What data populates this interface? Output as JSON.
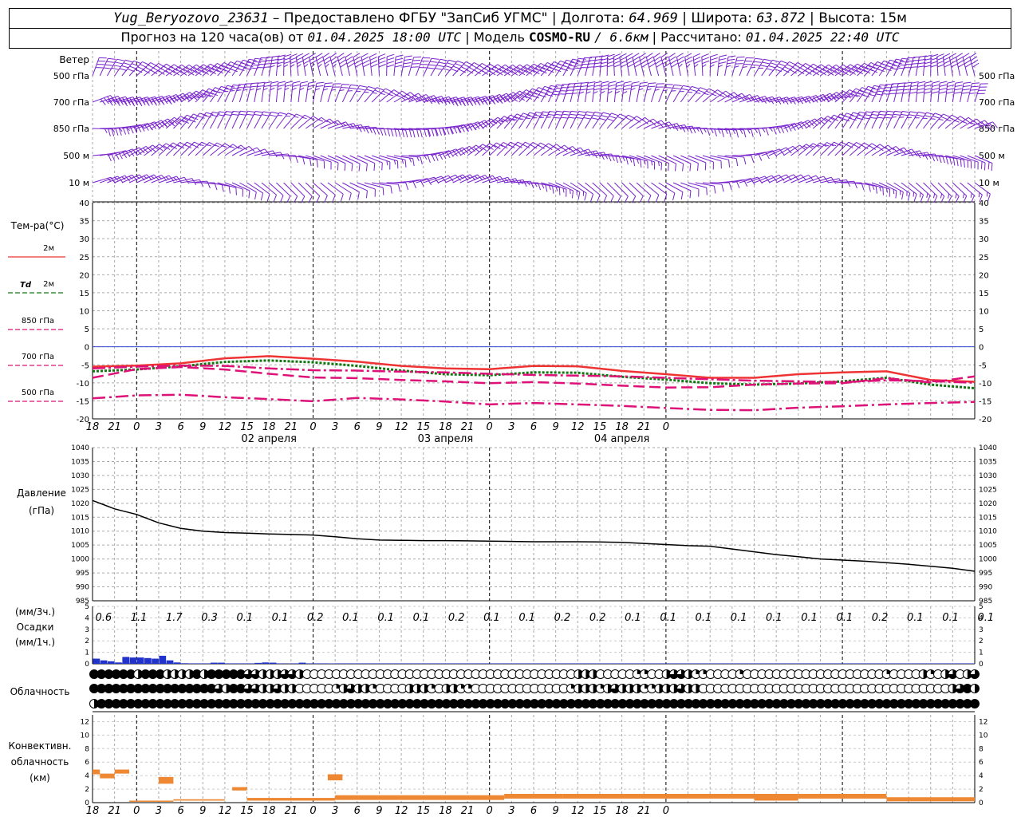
{
  "header": {
    "station": "Yug_Beryozovo_23631",
    "provider": "– Предоставлено ФГБУ \"ЗапСиб УГМС\"",
    "lon_label": "Долгота:",
    "lon": "64.969",
    "lat_label": "Широта:",
    "lat": "63.872",
    "alt_label": "Высота:",
    "alt": "15м",
    "forecast_prefix": "Прогноз на 120 часа(ов) от",
    "forecast_time": "01.04.2025 18:00 UTC",
    "model_label": "Модель",
    "model_name": "COSMO-RU",
    "model_res": "/ 6.6км",
    "calc_label": "Рассчитано:",
    "calc_time": "01.04.2025 22:40 UTC"
  },
  "panel_labels": {
    "wind": "Ветер",
    "wind_levels": [
      "500 гПа",
      "700 гПа",
      "850 гПа",
      "500 м",
      "10 м"
    ],
    "temp": "Тем-ра(°C)",
    "temp_2m": "2м",
    "td_prefix": "Td",
    "td_2m": "2м",
    "t850": "850 гПа",
    "t700": "700 гПа",
    "t500": "500 гПа",
    "pressure": "Давление",
    "pressure_unit": "(гПа)",
    "precip_3h": "(мм/3ч.)",
    "precip": "Осадки",
    "precip_1h": "(мм/1ч.)",
    "cloud": "Облачность",
    "conv1": "Конвективн.",
    "conv2": "облачность",
    "conv3": "(км)"
  },
  "dates": [
    "02 апреля",
    "03 апреля",
    "04 апреля"
  ],
  "hour_ticks": [
    "18",
    "21",
    "0",
    "3",
    "6",
    "9",
    "12",
    "15",
    "18",
    "21",
    "0",
    "3",
    "6",
    "9",
    "12",
    "15",
    "18",
    "21",
    "0",
    "3",
    "6",
    "9",
    "12",
    "15",
    "18",
    "21",
    "0"
  ],
  "temp_axis": [
    "40",
    "35",
    "30",
    "25",
    "20",
    "15",
    "10",
    "5",
    "0",
    "-5",
    "-10",
    "-15",
    "-20"
  ],
  "pressure_axis": [
    "1040",
    "1035",
    "1030",
    "1025",
    "1020",
    "1015",
    "1010",
    "1005",
    "1000",
    "995",
    "990",
    "985"
  ],
  "precip_axis": [
    "5",
    "4",
    "3",
    "2",
    "1",
    "0"
  ],
  "conv_axis": [
    "12",
    "10",
    "8",
    "6",
    "4",
    "2",
    "0"
  ],
  "colors": {
    "t2m": "#ee3333",
    "td2m": "#117711",
    "t850": "#dd1177",
    "t700": "#dd1177",
    "t500": "#dd1177",
    "pressure": "#000000",
    "precip": "#2233cc",
    "conv": "#ee8833",
    "wind": "#7722cc",
    "zero_line": "#3344cc"
  },
  "chart_data": [
    {
      "type": "line",
      "title": "Тем-ра(°C)",
      "x_hours": [
        0,
        6,
        12,
        18,
        24,
        30,
        36,
        42,
        48,
        54,
        60,
        66,
        72,
        78,
        84,
        90,
        96,
        102,
        108,
        114,
        120
      ],
      "ylim": [
        -20,
        40
      ],
      "series": [
        {
          "name": "2м",
          "values": [
            -5.5,
            -5.2,
            -4.6,
            -3.2,
            -2.6,
            -3.3,
            -4.1,
            -5.3,
            -6.0,
            -6.2,
            -5.3,
            -5.4,
            -6.7,
            -7.6,
            -8.6,
            -8.6,
            -7.6,
            -7.1,
            -6.8,
            -9.2,
            -9.7
          ]
        },
        {
          "name": "Td 2м",
          "values": [
            -6.8,
            -6.3,
            -5.4,
            -4.2,
            -3.8,
            -4.3,
            -5.3,
            -6.6,
            -7.6,
            -7.9,
            -7.1,
            -7.2,
            -8.3,
            -9.1,
            -10.1,
            -10.5,
            -10.2,
            -9.6,
            -8.6,
            -10.5,
            -11.5
          ]
        },
        {
          "name": "850 гПа",
          "values": [
            -8.6,
            -6.2,
            -5.6,
            -6.3,
            -7.5,
            -8.5,
            -8.7,
            -9.2,
            -9.6,
            -10.1,
            -9.8,
            -10.2,
            -10.8,
            -11.3,
            -11.2,
            -10.5,
            -10.2,
            -10.1,
            -8.7,
            -9.9,
            -8.2
          ]
        },
        {
          "name": "700 гПа",
          "values": [
            -6.0,
            -5.5,
            -5.2,
            -5.3,
            -6.0,
            -6.5,
            -6.6,
            -6.9,
            -7.1,
            -7.5,
            -7.8,
            -8.0,
            -8.2,
            -8.6,
            -9.0,
            -9.4,
            -9.6,
            -9.8,
            -9.3,
            -9.5,
            -10.0
          ]
        },
        {
          "name": "500 гПа",
          "values": [
            -14.3,
            -13.5,
            -13.3,
            -14.0,
            -14.5,
            -15.1,
            -14.2,
            -14.6,
            -15.2,
            -16.0,
            -15.6,
            -16.0,
            -16.4,
            -17.0,
            -17.5,
            -17.6,
            -16.9,
            -16.5,
            -16.0,
            -15.6,
            -15.3
          ]
        }
      ]
    },
    {
      "type": "line",
      "title": "Давление",
      "ylabel": "(гПа)",
      "x_hours": [
        0,
        3,
        6,
        9,
        12,
        15,
        18,
        21,
        24,
        27,
        30,
        33,
        36,
        39,
        42,
        45,
        48,
        51,
        54,
        57,
        60,
        63,
        66,
        69,
        72,
        75,
        78,
        81,
        84,
        87,
        90,
        93,
        96,
        99,
        102,
        105,
        108,
        111,
        114,
        117,
        120
      ],
      "ylim": [
        985,
        1040
      ],
      "series": [
        {
          "name": "Давление",
          "values": [
            1021,
            1018,
            1016,
            1013,
            1011,
            1010,
            1009.5,
            1009.3,
            1009,
            1008.8,
            1008.6,
            1008,
            1007.3,
            1006.8,
            1006.7,
            1006.6,
            1006.6,
            1006.5,
            1006.4,
            1006.3,
            1006.2,
            1006.2,
            1006.2,
            1006.1,
            1006,
            1005.6,
            1005.2,
            1004.8,
            1004.6,
            1003.6,
            1002.6,
            1001.6,
            1000.8,
            1000,
            999.6,
            999.2,
            998.7,
            998.1,
            997.4,
            996.7,
            995.6
          ]
        }
      ]
    },
    {
      "type": "bar",
      "title": "Осадки",
      "ylabel": "(мм/3ч.) (мм/1ч.)",
      "ylim": [
        0,
        5
      ],
      "labels_3h": [
        "0.6",
        "1.1",
        "1.7",
        "0.3",
        "0.1",
        "0.1",
        "0.2",
        "0.1",
        "0.1",
        "0.1",
        "0.2",
        "0.1",
        "0.1",
        "0.2",
        "0.2",
        "0.1",
        "0.1",
        "0.1",
        "0.1",
        "0.1",
        "0.1",
        "0.1",
        "0.2",
        "0.1",
        "0.1",
        "0.1"
      ],
      "hourly_start_hour": 1,
      "hourly_values": [
        0.45,
        0.3,
        0.22,
        0.12,
        0.6,
        0.55,
        0.55,
        0.5,
        0.45,
        0.7,
        0.3,
        0.12,
        0.05,
        0.04,
        0.04,
        0.04,
        0.1,
        0.1,
        0.04,
        0.04,
        0.04,
        0.04,
        0.08,
        0.12,
        0.1,
        0.04,
        0.02,
        0.04,
        0.1,
        0.04,
        0.04,
        0.04,
        0.03,
        0.04,
        0.04,
        0.04,
        0.04,
        0.04,
        0.04,
        0.04,
        0.04,
        0.04,
        0.04,
        0.04,
        0.04,
        0.04,
        0.04,
        0.04,
        0.04,
        0.04,
        0.04,
        0.04,
        0.04,
        0.04,
        0.04,
        0.04,
        0.04,
        0.04,
        0.04,
        0.04,
        0.04,
        0.04,
        0.04,
        0.04,
        0.04,
        0.04,
        0.04,
        0.04,
        0.04,
        0.04,
        0.04,
        0.04,
        0.04,
        0.04,
        0.04,
        0.04,
        0.04,
        0.04,
        0.04,
        0.04,
        0.04,
        0.04,
        0.04,
        0.04,
        0.04,
        0.04,
        0.04,
        0.04,
        0.04,
        0.04,
        0.04,
        0.04,
        0.04,
        0.04,
        0.04,
        0.04,
        0.04,
        0.04,
        0.04,
        0.04,
        0.04,
        0.04,
        0.04,
        0.04,
        0.04,
        0.04,
        0.04,
        0.04,
        0.04,
        0.04,
        0.04,
        0.04,
        0.04,
        0.04,
        0.04,
        0.04,
        0.04,
        0.04,
        0.04,
        0.04
      ]
    },
    {
      "type": "table",
      "title": "Облачность",
      "rows": 3,
      "cover_high": [
        1,
        1,
        1,
        1,
        1,
        1,
        0.5,
        1,
        1,
        1,
        0.5,
        0.5,
        0.5,
        0.5,
        1,
        0.5,
        1,
        1,
        1,
        1,
        1,
        0.75,
        0.75,
        0.5,
        0.5,
        0.5,
        0.75,
        0.75,
        0.5,
        0,
        0,
        0,
        0,
        0,
        0,
        0,
        0,
        0,
        0,
        0,
        0,
        0,
        0,
        0,
        0,
        0,
        0,
        0,
        0,
        0,
        0,
        0,
        0,
        0,
        0,
        0,
        0,
        0,
        0,
        0,
        0,
        0,
        0,
        0,
        0,
        0,
        0.5,
        0.5,
        0.5,
        0,
        0,
        0,
        0,
        0,
        0.25,
        0.25,
        0,
        0,
        0.5,
        0.75,
        0.75,
        0.5,
        0.25,
        0.25,
        0,
        0,
        0,
        0,
        0.25,
        0,
        0,
        0,
        0,
        0,
        0,
        0,
        0,
        0,
        0,
        0,
        0,
        0,
        0,
        0,
        0,
        0,
        0,
        0,
        0.25,
        0,
        0,
        0,
        0,
        0.5,
        0.25,
        0,
        0.5,
        0.75,
        0,
        0.5,
        0.75,
        0.5
      ],
      "cover_mid": [
        1,
        1,
        1,
        1,
        1,
        1,
        1,
        1,
        1,
        1,
        1,
        1,
        1,
        1,
        1,
        1,
        1,
        0.75,
        0.5,
        1,
        1,
        0.75,
        0.75,
        0.5,
        0.5,
        0.75,
        0.5,
        0.5,
        0,
        0,
        0,
        0,
        0,
        0.25,
        0.5,
        0.75,
        0.5,
        0.5,
        0.25,
        0,
        0,
        0,
        0,
        0.5,
        0.5,
        0.5,
        0.25,
        0,
        0.5,
        0.5,
        0.25,
        0.25,
        0,
        0,
        0,
        0,
        0,
        0,
        0,
        0,
        0,
        0,
        0,
        0,
        0,
        0.25,
        0.5,
        0.5,
        0.5,
        0.25,
        0.5,
        0.75,
        0.5,
        0.5,
        0.5,
        0.25,
        0.25,
        0.5,
        0.5,
        0.5,
        0.75,
        0.5,
        0.5,
        0,
        0,
        0,
        0,
        0,
        0,
        0,
        0,
        0,
        0,
        0,
        0,
        0,
        0,
        0,
        0,
        0,
        0,
        0,
        0,
        0,
        0,
        0,
        0,
        0,
        0,
        0,
        0,
        0,
        0,
        0,
        0,
        0,
        0,
        0.5,
        0.75,
        1,
        0.5,
        0.75,
        0.75
      ],
      "cover_low": [
        0.5,
        1,
        1,
        1,
        1,
        1,
        1,
        1,
        1,
        1,
        1,
        1,
        1,
        1,
        1,
        1,
        1,
        1,
        1,
        1,
        1,
        1,
        1,
        1,
        1,
        1,
        1,
        1,
        1,
        1,
        1,
        1,
        1,
        1,
        1,
        1,
        1,
        1,
        1,
        1,
        1,
        1,
        1,
        1,
        1,
        1,
        1,
        1,
        1,
        1,
        1,
        1,
        1,
        1,
        1,
        1,
        1,
        1,
        1,
        1,
        1,
        1,
        1,
        1,
        1,
        1,
        1,
        1,
        1,
        1,
        1,
        1,
        1,
        1,
        1,
        1,
        1,
        1,
        1,
        1,
        1,
        1,
        1,
        1,
        1,
        1,
        1,
        1,
        1,
        1,
        1,
        1,
        1,
        1,
        1,
        1,
        1,
        1,
        1,
        1,
        1,
        1,
        1,
        1,
        1,
        1,
        1,
        1,
        1,
        1,
        1,
        1,
        1,
        1,
        1,
        1,
        1,
        1,
        1,
        1,
        1
      ]
    },
    {
      "type": "bar",
      "title": "Конвективн. облачность (км)",
      "ylim": [
        0,
        13
      ],
      "segments_hours": [
        {
          "start": 0,
          "end": 1,
          "bottom": 4.2,
          "top": 4.9
        },
        {
          "start": 1,
          "end": 3,
          "bottom": 3.6,
          "top": 4.3
        },
        {
          "start": 3,
          "end": 5,
          "bottom": 4.3,
          "top": 4.9
        },
        {
          "start": 5,
          "end": 11,
          "bottom": 0.2,
          "top": 0.3
        },
        {
          "start": 9,
          "end": 11,
          "bottom": 2.8,
          "top": 3.8
        },
        {
          "start": 11,
          "end": 18,
          "bottom": 0.3,
          "top": 0.5
        },
        {
          "start": 19,
          "end": 21,
          "bottom": 1.8,
          "top": 2.3
        },
        {
          "start": 21,
          "end": 33,
          "bottom": 0.3,
          "top": 0.7
        },
        {
          "start": 32,
          "end": 34,
          "bottom": 3.3,
          "top": 4.2
        },
        {
          "start": 33,
          "end": 56,
          "bottom": 0.4,
          "top": 1.1
        },
        {
          "start": 56,
          "end": 64,
          "bottom": 0.6,
          "top": 1.3
        },
        {
          "start": 64,
          "end": 78,
          "bottom": 0.6,
          "top": 1.3
        },
        {
          "start": 78,
          "end": 93,
          "bottom": 0.6,
          "top": 1.3
        },
        {
          "start": 90,
          "end": 96,
          "bottom": 0.3,
          "top": 1.3
        },
        {
          "start": 96,
          "end": 108,
          "bottom": 0.6,
          "top": 1.3
        },
        {
          "start": 108,
          "end": 120,
          "bottom": 0.2,
          "top": 0.8
        }
      ]
    }
  ]
}
